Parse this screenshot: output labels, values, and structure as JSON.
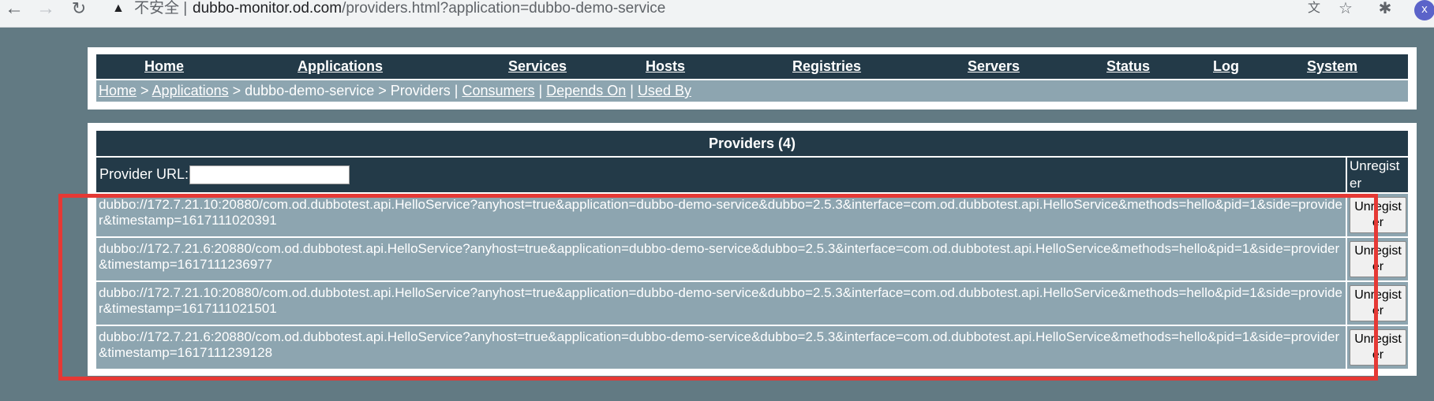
{
  "browser": {
    "insecure_label": "不安全",
    "separator": "|",
    "url_host": "dubbo-monitor.od.com",
    "url_path": "/providers.html?application=dubbo-demo-service",
    "avatar_letter": "x",
    "icons": [
      "back-icon",
      "forward-icon",
      "reload-icon",
      "warning-icon",
      "translate-icon",
      "star-icon",
      "extensions-icon"
    ]
  },
  "menu": {
    "items": [
      "Home",
      "Applications",
      "Services",
      "Hosts",
      "Registries",
      "Servers",
      "Status",
      "Log",
      "System"
    ]
  },
  "breadcrumb": {
    "home": "Home",
    "sep1": " > ",
    "applications": "Applications",
    "sep2": " > ",
    "application": "dubbo-demo-service",
    "sep3": " > ",
    "current": "Providers",
    "pipe1": " | ",
    "consumers": "Consumers",
    "pipe2": " | ",
    "depends_on": "Depends On",
    "pipe3": " | ",
    "used_by": "Used By"
  },
  "providers": {
    "caption": "Providers (4)",
    "filter_label": "Provider URL:",
    "filter_value": "",
    "action_header": "Unregister",
    "action_label": "Unregister",
    "rows": [
      "dubbo://172.7.21.10:20880/com.od.dubbotest.api.HelloService?anyhost=true&application=dubbo-demo-service&dubbo=2.5.3&interface=com.od.dubbotest.api.HelloService&methods=hello&pid=1&side=provider&timestamp=1617111020391",
      "dubbo://172.7.21.6:20880/com.od.dubbotest.api.HelloService?anyhost=true&application=dubbo-demo-service&dubbo=2.5.3&interface=com.od.dubbotest.api.HelloService&methods=hello&pid=1&side=provider&timestamp=1617111236977",
      "dubbo://172.7.21.10:20880/com.od.dubbotest.api.HelloService?anyhost=true&application=dubbo-demo-service&dubbo=2.5.3&interface=com.od.dubbotest.api.HelloService&methods=hello&pid=1&side=provider&timestamp=1617111021501",
      "dubbo://172.7.21.6:20880/com.od.dubbotest.api.HelloService?anyhost=true&application=dubbo-demo-service&dubbo=2.5.3&interface=com.od.dubbotest.api.HelloService&methods=hello&pid=1&side=provider&timestamp=1617111239128"
    ]
  },
  "colors": {
    "page_bg": "#627a83",
    "header_dark": "#233a48",
    "row_bg": "#8da5b0",
    "highlight": "#e53935"
  }
}
